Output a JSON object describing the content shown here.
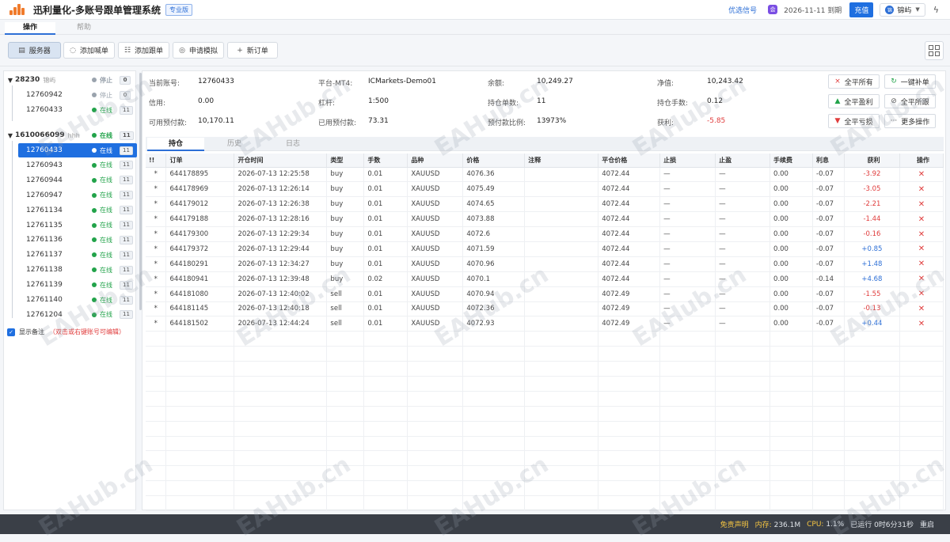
{
  "app": {
    "title": "迅利量化-多账号跟单管理系统",
    "edition": "专业版"
  },
  "topbar": {
    "signal": "优选信号",
    "vip_icon": "会",
    "expire": "2026-11-11 到期",
    "recharge": "充值",
    "user": "锦屿",
    "avatar": "锦",
    "power_icon": "ϟ"
  },
  "tabs": [
    {
      "label": "操作"
    },
    {
      "label": "帮助"
    }
  ],
  "toolbar": [
    {
      "label": "服务器",
      "icon": "▤"
    },
    {
      "label": "添加喊单",
      "icon": "◌"
    },
    {
      "label": "添加跟单",
      "icon": "☷"
    },
    {
      "label": "申请模拟",
      "icon": "◎"
    },
    {
      "label": "新订单",
      "icon": "+"
    }
  ],
  "tree": {
    "groups": [
      {
        "id": "28230",
        "alias": "锦屿",
        "status": "停止",
        "count": "0",
        "children": [
          {
            "id": "12760942",
            "status": "停止",
            "count": "0"
          },
          {
            "id": "12760433",
            "status": "在线",
            "count": "11"
          }
        ]
      },
      {
        "id": "1610066099",
        "alias": "hhh",
        "status": "在线",
        "count": "11",
        "children": [
          {
            "id": "12760433",
            "status": "在线",
            "count": "11"
          },
          {
            "id": "12760943",
            "status": "在线",
            "count": "11"
          },
          {
            "id": "12760944",
            "status": "在线",
            "count": "11"
          },
          {
            "id": "12760947",
            "status": "在线",
            "count": "11"
          },
          {
            "id": "12761134",
            "status": "在线",
            "count": "11"
          },
          {
            "id": "12761135",
            "status": "在线",
            "count": "11"
          },
          {
            "id": "12761136",
            "status": "在线",
            "count": "11"
          },
          {
            "id": "12761137",
            "status": "在线",
            "count": "11"
          },
          {
            "id": "12761138",
            "status": "在线",
            "count": "11"
          },
          {
            "id": "12761139",
            "status": "在线",
            "count": "11"
          },
          {
            "id": "12761140",
            "status": "在线",
            "count": "11"
          },
          {
            "id": "12761204",
            "status": "在线",
            "count": "11"
          }
        ]
      }
    ],
    "show_remark": "显示备注",
    "remark_hint": "（双击或右键账号可编辑）",
    "check_mark": "✓"
  },
  "info": {
    "current_account_label": "当前账号:",
    "current_account": "12760433",
    "platform_label": "平台-MT4:",
    "platform": "ICMarkets-Demo01",
    "balance_label": "余额:",
    "balance": "10,249.27",
    "equity_label": "净值:",
    "equity": "10,243.42",
    "credit_label": "信用:",
    "credit": "0.00",
    "leverage_label": "杠杆:",
    "leverage": "1:500",
    "orders_label": "持仓单数:",
    "orders": "11",
    "lots_label": "持仓手数:",
    "lots": "0.12",
    "free_margin_label": "可用预付款:",
    "free_margin": "10,170.11",
    "used_margin_label": "已用预付款:",
    "used_margin": "73.31",
    "margin_ratio_label": "预付款比例:",
    "margin_ratio": "13973%",
    "profit_label": "获利:",
    "profit": "-5.85"
  },
  "actions": [
    {
      "label": "全平所有",
      "icon": "×",
      "tone": "red"
    },
    {
      "label": "一键补单",
      "icon": "↻",
      "tone": "green"
    },
    {
      "label": "全平盈利",
      "icon": "▲",
      "tone": "green"
    },
    {
      "label": "全平所跟",
      "icon": "⊘",
      "tone": "gray"
    },
    {
      "label": "全平亏损",
      "icon": "▼",
      "tone": "red"
    },
    {
      "label": "更多操作",
      "icon": "···",
      "tone": "gray"
    }
  ],
  "subtabs": [
    {
      "label": "持仓"
    },
    {
      "label": "历史"
    },
    {
      "label": "日志"
    }
  ],
  "table": {
    "columns": [
      "!!",
      "订单",
      "开仓时间",
      "类型",
      "手数",
      "品种",
      "价格",
      "注释",
      "平仓价格",
      "止损",
      "止盈",
      "手续费",
      "利息",
      "获利",
      "操作"
    ],
    "rows": [
      {
        "flag": "*",
        "order": "644178895",
        "time": "2026-07-13 12:25:58",
        "type": "buy",
        "lots": "0.01",
        "symbol": "XAUUSD",
        "price": "4076.36",
        "comment": "",
        "close": "4072.44",
        "sl": "—",
        "tp": "—",
        "fee": "0.00",
        "swap": "-0.07",
        "profit": "-3.92",
        "op": "✕"
      },
      {
        "flag": "*",
        "order": "644178969",
        "time": "2026-07-13 12:26:14",
        "type": "buy",
        "lots": "0.01",
        "symbol": "XAUUSD",
        "price": "4075.49",
        "comment": "",
        "close": "4072.44",
        "sl": "—",
        "tp": "—",
        "fee": "0.00",
        "swap": "-0.07",
        "profit": "-3.05",
        "op": "✕"
      },
      {
        "flag": "*",
        "order": "644179012",
        "time": "2026-07-13 12:26:38",
        "type": "buy",
        "lots": "0.01",
        "symbol": "XAUUSD",
        "price": "4074.65",
        "comment": "",
        "close": "4072.44",
        "sl": "—",
        "tp": "—",
        "fee": "0.00",
        "swap": "-0.07",
        "profit": "-2.21",
        "op": "✕"
      },
      {
        "flag": "*",
        "order": "644179188",
        "time": "2026-07-13 12:28:16",
        "type": "buy",
        "lots": "0.01",
        "symbol": "XAUUSD",
        "price": "4073.88",
        "comment": "",
        "close": "4072.44",
        "sl": "—",
        "tp": "—",
        "fee": "0.00",
        "swap": "-0.07",
        "profit": "-1.44",
        "op": "✕"
      },
      {
        "flag": "*",
        "order": "644179300",
        "time": "2026-07-13 12:29:34",
        "type": "buy",
        "lots": "0.01",
        "symbol": "XAUUSD",
        "price": "4072.6",
        "comment": "",
        "close": "4072.44",
        "sl": "—",
        "tp": "—",
        "fee": "0.00",
        "swap": "-0.07",
        "profit": "-0.16",
        "op": "✕"
      },
      {
        "flag": "*",
        "order": "644179372",
        "time": "2026-07-13 12:29:44",
        "type": "buy",
        "lots": "0.01",
        "symbol": "XAUUSD",
        "price": "4071.59",
        "comment": "",
        "close": "4072.44",
        "sl": "—",
        "tp": "—",
        "fee": "0.00",
        "swap": "-0.07",
        "profit": "+0.85",
        "op": "✕"
      },
      {
        "flag": "*",
        "order": "644180291",
        "time": "2026-07-13 12:34:27",
        "type": "buy",
        "lots": "0.01",
        "symbol": "XAUUSD",
        "price": "4070.96",
        "comment": "",
        "close": "4072.44",
        "sl": "—",
        "tp": "—",
        "fee": "0.00",
        "swap": "-0.07",
        "profit": "+1.48",
        "op": "✕"
      },
      {
        "flag": "*",
        "order": "644180941",
        "time": "2026-07-13 12:39:48",
        "type": "buy",
        "lots": "0.02",
        "symbol": "XAUUSD",
        "price": "4070.1",
        "comment": "",
        "close": "4072.44",
        "sl": "—",
        "tp": "—",
        "fee": "0.00",
        "swap": "-0.14",
        "profit": "+4.68",
        "op": "✕"
      },
      {
        "flag": "*",
        "order": "644181080",
        "time": "2026-07-13 12:40:02",
        "type": "sell",
        "lots": "0.01",
        "symbol": "XAUUSD",
        "price": "4070.94",
        "comment": "",
        "close": "4072.49",
        "sl": "—",
        "tp": "—",
        "fee": "0.00",
        "swap": "-0.07",
        "profit": "-1.55",
        "op": "✕"
      },
      {
        "flag": "*",
        "order": "644181145",
        "time": "2026-07-13 12:40:18",
        "type": "sell",
        "lots": "0.01",
        "symbol": "XAUUSD",
        "price": "4072.36",
        "comment": "",
        "close": "4072.49",
        "sl": "—",
        "tp": "—",
        "fee": "0.00",
        "swap": "-0.07",
        "profit": "-0.13",
        "op": "✕"
      },
      {
        "flag": "*",
        "order": "644181502",
        "time": "2026-07-13 12:44:24",
        "type": "sell",
        "lots": "0.01",
        "symbol": "XAUUSD",
        "price": "4072.93",
        "comment": "",
        "close": "4072.49",
        "sl": "—",
        "tp": "—",
        "fee": "0.00",
        "swap": "-0.07",
        "profit": "+0.44",
        "op": "✕"
      }
    ]
  },
  "status": {
    "disclaimer": "免责声明",
    "mem_label": "内存:",
    "mem": "236.1M",
    "cpu_label": "CPU:",
    "cpu": "1.1%",
    "uptime": "已运行 0时6分31秒",
    "restart": "重启"
  },
  "watermark": "EAHub.cn"
}
